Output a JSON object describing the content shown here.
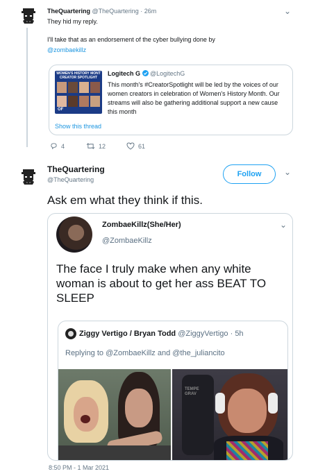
{
  "top_tweet": {
    "display_name": "TheQuartering",
    "handle": "@TheQuartering",
    "separator": "·",
    "time": "26m",
    "text_line1": "They hid my reply.",
    "text_line2": "I'll take that as an endorsement of the cyber bullying done by",
    "mention": "@zombaekillz",
    "quote": {
      "thumb_title": "WOMEN'S HISTORY MONT CREATOR SPOTLIGHT",
      "thumb_footer": "OF",
      "display_name": "Logitech G",
      "handle": "@LogitechG",
      "text": "This month's #CreatorSpotlight will be led by the voices of our women creators in celebration of Women's History Month. Our streams will also be gathering additional support a new cause this month",
      "show_thread": "Show this thread"
    },
    "actions": {
      "replies": "4",
      "retweets": "12",
      "likes": "61"
    }
  },
  "main_tweet": {
    "display_name": "TheQuartering",
    "handle": "@TheQuartering",
    "follow_label": "Follow",
    "text": "Ask em what they think if this.",
    "quote": {
      "display_name": "ZombaeKillz(She/Her)",
      "handle": "@ZombaeKillz",
      "text": "The face I truly make when any white woman is about to get her ass BEAT TO SLEEP",
      "inner_quote": {
        "display_name": "Ziggy Vertigo / Bryan Todd",
        "handle": "@ZiggyVertigo",
        "separator": "·",
        "time": "5h",
        "replying_prefix": "Replying to",
        "replying_users": "@ZombaeKillz and @the_juliancito",
        "right_image_text": "TEMPE GRAV"
      }
    },
    "timestamp": "8:50 PM - 1 Mar 2021"
  },
  "colors": {
    "link": "#1b95e0",
    "follow": "#1da1f2",
    "border": "#ccd6dd",
    "muted": "#657786"
  }
}
